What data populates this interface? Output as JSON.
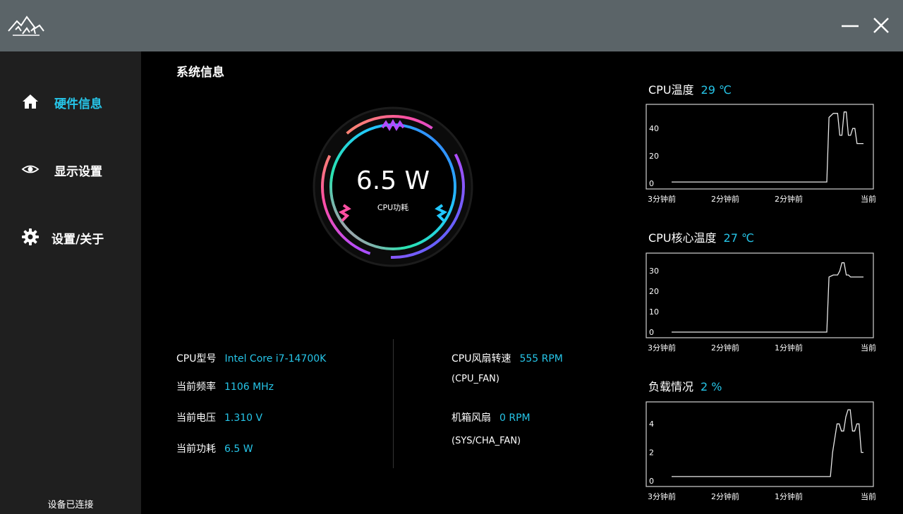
{
  "titlebar": {
    "logo_icon": "mountain-logo-icon",
    "minimize_icon": "minimize-icon",
    "close_icon": "close-icon"
  },
  "sidebar": {
    "items": [
      {
        "label": "硬件信息",
        "icon": "home-icon",
        "active": true
      },
      {
        "label": "显示设置",
        "icon": "eye-icon",
        "active": false
      },
      {
        "label": "设置/关于",
        "icon": "gear-icon",
        "active": false
      }
    ],
    "status": "设备已连接"
  },
  "main": {
    "title": "系统信息",
    "gauge": {
      "value": "6.5 W",
      "label": "CPU功耗"
    },
    "left_info": [
      {
        "label": "CPU型号",
        "value": "Intel Core i7-14700K"
      },
      {
        "label": "当前频率",
        "value": "1106 MHz"
      },
      {
        "label": "当前电压",
        "value": "1.310 V"
      },
      {
        "label": "当前功耗",
        "value": "6.5 W"
      }
    ],
    "right_info": [
      {
        "label": "CPU风扇转速",
        "value": "555 RPM",
        "sub": "(CPU_FAN)"
      },
      {
        "label": "机箱风扇",
        "value": "0 RPM",
        "sub": "(SYS/CHA_FAN)"
      }
    ]
  },
  "colors": {
    "accent": "#26c5e8",
    "titlebar": "#5b6468",
    "sidebar": "#1f1f1f"
  },
  "chart_data": [
    {
      "type": "line",
      "title": "CPU温度",
      "current": "29 ℃",
      "x_labels": [
        "3分钟前",
        "2分钟前",
        "2分钟前",
        "当前"
      ],
      "y_ticks": [
        0,
        20,
        40
      ],
      "ylim": [
        0,
        55
      ],
      "x": [
        0,
        72,
        73,
        75,
        77,
        78,
        79,
        80,
        81,
        82,
        83,
        84,
        85,
        86,
        87,
        89
      ],
      "y": [
        1,
        1,
        48,
        51,
        51,
        35,
        35,
        52,
        52,
        35,
        35,
        40,
        40,
        29,
        29,
        29
      ]
    },
    {
      "type": "line",
      "title": "CPU核心温度",
      "current": "27 ℃",
      "x_labels": [
        "3分钟前",
        "2分钟前",
        "1分钟前",
        "当前"
      ],
      "y_ticks": [
        0,
        10,
        20,
        30
      ],
      "ylim": [
        0,
        37
      ],
      "x": [
        0,
        72,
        73,
        75,
        77,
        78,
        79,
        80,
        81,
        82,
        83,
        85,
        89
      ],
      "y": [
        0,
        0,
        27,
        28,
        28,
        30,
        34,
        34,
        28,
        28,
        27,
        27,
        27
      ]
    },
    {
      "type": "line",
      "title": "负载情况",
      "current": "2 %",
      "x_labels": [
        "3分钟前",
        "2分钟前",
        "1分钟前",
        "当前"
      ],
      "y_ticks": [
        0,
        2,
        4
      ],
      "ylim": [
        0,
        5.3
      ],
      "x": [
        0,
        72,
        73,
        75,
        76,
        77,
        78,
        79,
        80,
        81,
        82,
        83,
        84,
        85,
        86,
        87
      ],
      "y": [
        0.3,
        0.3,
        2,
        4,
        4,
        3.5,
        3.5,
        4.5,
        5,
        5,
        3.5,
        3.5,
        4,
        4,
        2,
        2
      ]
    }
  ]
}
